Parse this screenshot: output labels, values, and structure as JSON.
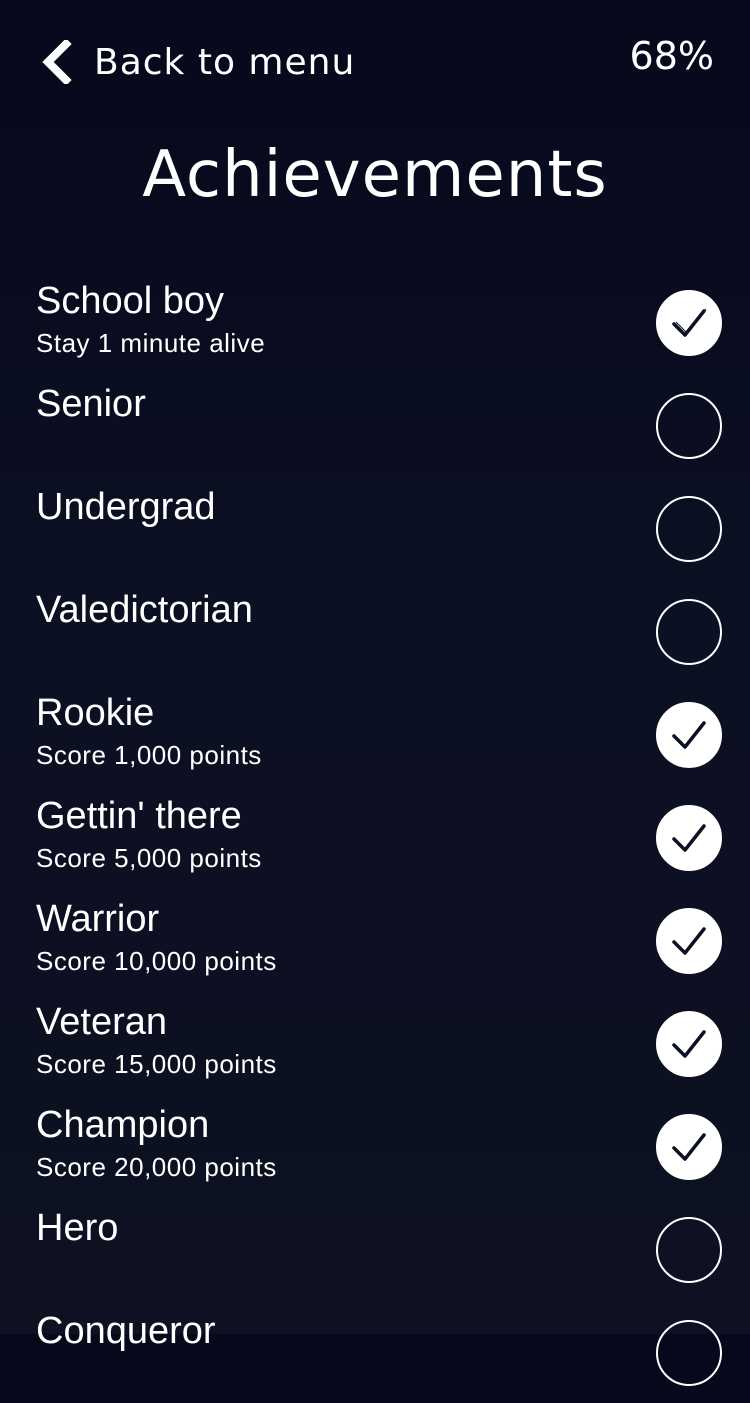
{
  "header": {
    "back_label": "Back to menu",
    "back_icon": "chevron-left-icon",
    "percent": "68%"
  },
  "title": "Achievements",
  "achievements": [
    {
      "name": "School boy",
      "description": "Stay 1 minute alive",
      "completed": true
    },
    {
      "name": "Senior",
      "description": "",
      "completed": false
    },
    {
      "name": "Undergrad",
      "description": "",
      "completed": false
    },
    {
      "name": "Valedictorian",
      "description": "",
      "completed": false
    },
    {
      "name": "Rookie",
      "description": "Score 1,000 points",
      "completed": true
    },
    {
      "name": "Gettin' there",
      "description": "Score 5,000 points",
      "completed": true
    },
    {
      "name": "Warrior",
      "description": "Score 10,000 points",
      "completed": true
    },
    {
      "name": "Veteran",
      "description": "Score 15,000 points",
      "completed": true
    },
    {
      "name": "Champion",
      "description": "Score 20,000 points",
      "completed": true
    },
    {
      "name": "Hero",
      "description": "",
      "completed": false
    },
    {
      "name": "Conqueror",
      "description": "",
      "completed": false
    }
  ],
  "colors": {
    "background": "#0b1022",
    "foreground": "#ffffff"
  }
}
